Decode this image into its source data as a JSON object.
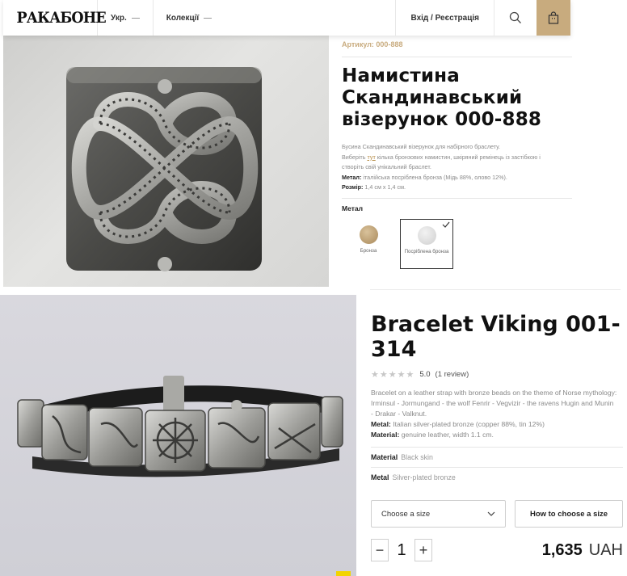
{
  "header": {
    "logo": "РАКАБОНЕ",
    "language": "Укр.",
    "collections": "Колекції",
    "login": "Вхід / Реєстрація",
    "icons": [
      "search-icon",
      "shopping-bag-icon"
    ]
  },
  "product_ua": {
    "sku": "Артикул: 000-888",
    "title": "Намистина Скандинавський візерунок 000-888",
    "desc_line1": "Бусина Скандинавський візерунок для набірного браслету.",
    "desc_pre_link": "Виберіть ",
    "desc_link": "тут",
    "desc_post_link": " кілька бронзових намистин, шкіряний ремінець із застібкою і створіть свій унікальний браслет.",
    "metal_label": "Метал:",
    "metal_value": " італійська посріблена бронза (Мідь 88%, олово 12%).",
    "size_label": "Розмір:",
    "size_value": " 1,4 см х 1,4 см.",
    "metal_section": "Метал",
    "options": [
      {
        "label": "Бронза",
        "color": "#b89968",
        "selected": false
      },
      {
        "label": "Посріблена бронза",
        "color": "#e6e6e6",
        "selected": true
      }
    ]
  },
  "product_en": {
    "title": "Bracelet Viking 001-314",
    "stars_count": 5,
    "rating": "5.0",
    "reviews": "(1 review)",
    "desc_main": "Bracelet on a leather strap with bronze beads on the theme of Norse mythology: Irminsul - Jormungand - the wolf Fenrir - Vegvizir - the ravens Hugin and Munin - Drakar - Valknut.",
    "metal_label": "Metal:",
    "metal_value": " Italian silver-plated bronze (copper 88%, tin 12%)",
    "material_label": "Material:",
    "material_value": " genuine leather, width 1.1 cm.",
    "attr_material_label": "Material",
    "attr_material_value": "Black skin",
    "attr_metal_label": "Metal",
    "attr_metal_value": "Silver-plated bronze",
    "size_select": "Choose a size",
    "size_help": "How to choose a size",
    "qty_minus": "−",
    "qty_value": "1",
    "qty_plus": "+",
    "price": "1,635",
    "currency": "UAH"
  },
  "colors": {
    "accent": "#c8ab7e",
    "link": "#b88f4a"
  }
}
